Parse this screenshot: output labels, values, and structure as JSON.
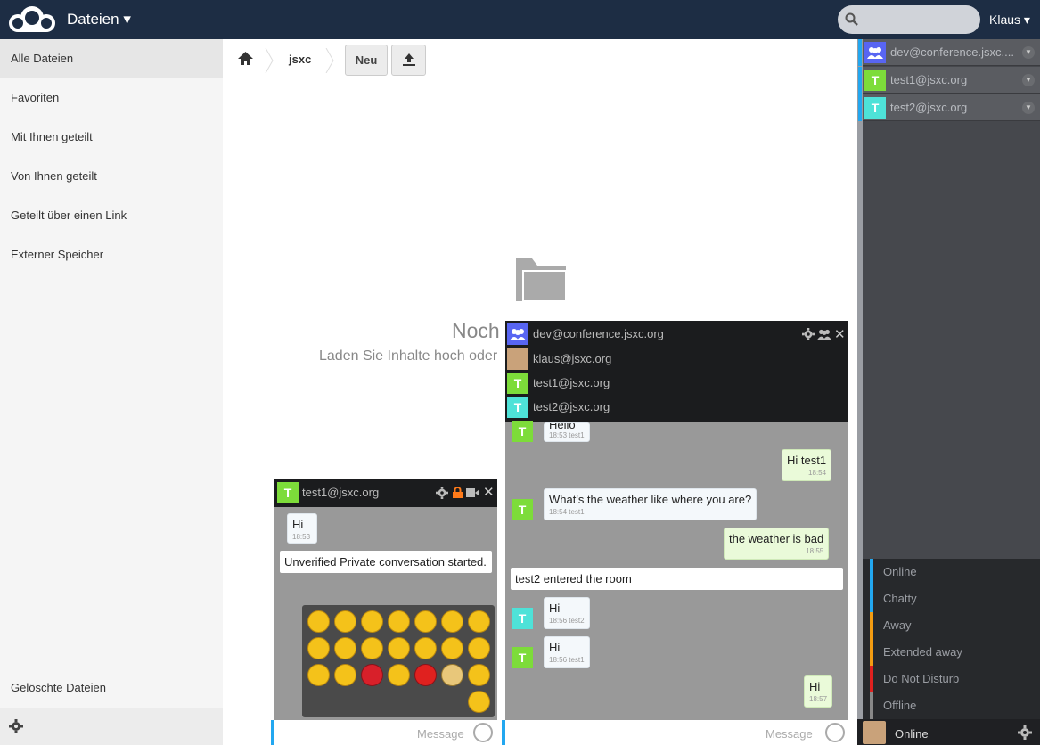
{
  "header": {
    "app_title": "Dateien ▾",
    "user": "Klaus ▾"
  },
  "sidebar": {
    "items": [
      {
        "label": "Alle Dateien",
        "active": true
      },
      {
        "label": "Favoriten"
      },
      {
        "label": "Mit Ihnen geteilt"
      },
      {
        "label": "Von Ihnen geteilt"
      },
      {
        "label": "Geteilt über einen Link"
      },
      {
        "label": "Externer Speicher"
      }
    ],
    "deleted": "Gelöschte Dateien"
  },
  "breadcrumb": {
    "folder": "jsxc",
    "new_label": "Neu"
  },
  "empty": {
    "title": "Noch",
    "subtitle": "Laden Sie Inhalte hoch oder"
  },
  "roster": {
    "items": [
      {
        "name": "dev@conference.jsxc....",
        "avatar": "group",
        "color": "#5865f2"
      },
      {
        "name": "test1@jsxc.org",
        "avatar": "T",
        "color": "#7ddc3a"
      },
      {
        "name": "test2@jsxc.org",
        "avatar": "T",
        "color": "#4ee2d8"
      }
    ]
  },
  "status": {
    "options": [
      {
        "label": "Online",
        "color": "#22a7f0"
      },
      {
        "label": "Chatty",
        "color": "#22a7f0"
      },
      {
        "label": "Away",
        "color": "#f39c12"
      },
      {
        "label": "Extended away",
        "color": "#f39c12"
      },
      {
        "label": "Do Not Disturb",
        "color": "#e0211f"
      },
      {
        "label": "Offline",
        "color": "#888888"
      }
    ],
    "current": "Online"
  },
  "chat1": {
    "title": "test1@jsxc.org",
    "avatar": "T",
    "messages": [
      {
        "text": "Hi",
        "time": "18:53"
      }
    ],
    "system": "Unverified Private conversation started.",
    "input_placeholder": "Message"
  },
  "chat2": {
    "title": "dev@conference.jsxc.org",
    "members": [
      "klaus@jsxc.org",
      "test1@jsxc.org",
      "test2@jsxc.org"
    ],
    "messages": [
      {
        "text": "Hello",
        "time": "18:53 test1"
      },
      {
        "text": "Hi test1",
        "time": "18:54"
      },
      {
        "text": "What's the weather like where you are?",
        "time": "18:54 test1"
      },
      {
        "text": "the weather is bad",
        "time": "18:55"
      },
      {
        "text": "Hi",
        "time": "18:56 test2"
      },
      {
        "text": "Hi",
        "time": "18:56 test1"
      },
      {
        "text": "Hi",
        "time": "18:57"
      }
    ],
    "system": "test2 entered the room",
    "input_placeholder": "Message"
  },
  "colors": {
    "header": "#1d2d44",
    "accent": "#22a7f0",
    "avatar_test1": "#7ddc3a",
    "avatar_test2": "#4ee2d8"
  }
}
